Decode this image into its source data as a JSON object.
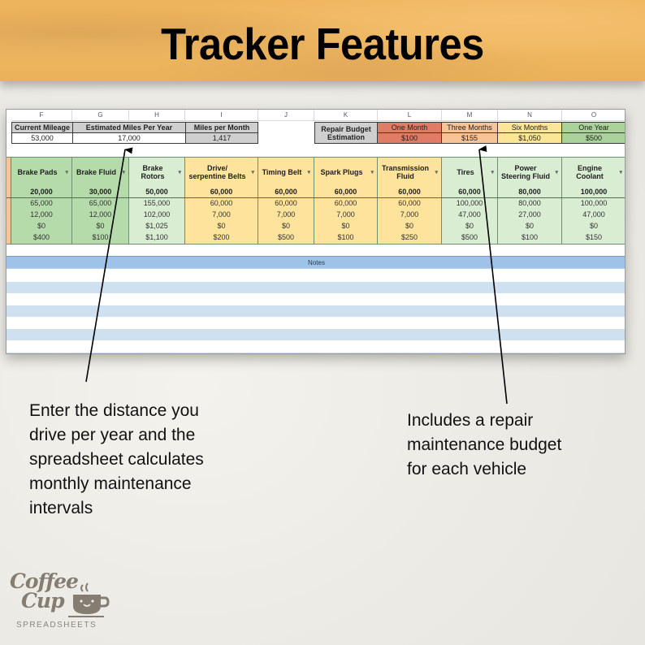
{
  "banner": {
    "title": "Tracker Features"
  },
  "sheet": {
    "column_letters": [
      "F",
      "G",
      "H",
      "I",
      "J",
      "K",
      "L",
      "M",
      "N",
      "O"
    ],
    "mileage": {
      "current_label": "Current Mileage",
      "current_value": "53,000",
      "estimated_label": "Estimated Miles Per Year",
      "estimated_value": "17,000",
      "per_month_label": "Miles per Month",
      "per_month_value": "1,417"
    },
    "budget": {
      "label": "Repair Budget Estimation",
      "periods": [
        {
          "label": "One Month",
          "value": "$100",
          "color": "#e07b67"
        },
        {
          "label": "Three Months",
          "value": "$155",
          "color": "#f7c49a"
        },
        {
          "label": "Six Months",
          "value": "$1,050",
          "color": "#fde597"
        },
        {
          "label": "One Year",
          "value": "$500",
          "color": "#a9d39a"
        }
      ]
    },
    "maintenance_items": [
      {
        "name": "Brake Pads",
        "interval": "20,000",
        "values": [
          "65,000",
          "12,000",
          "$0",
          "$400"
        ],
        "color": "#b6dbab"
      },
      {
        "name": "Brake Fluid",
        "interval": "30,000",
        "values": [
          "65,000",
          "12,000",
          "$0",
          "$100"
        ],
        "color": "#b6dbab"
      },
      {
        "name": "Brake\nRotors",
        "interval": "50,000",
        "values": [
          "155,000",
          "102,000",
          "$1,025",
          "$1,100"
        ],
        "color": "#d9edd3"
      },
      {
        "name": "Drive/\nserpentine Belts",
        "interval": "60,000",
        "values": [
          "60,000",
          "7,000",
          "$0",
          "$200"
        ],
        "color": "#fde39b"
      },
      {
        "name": "Timing Belt",
        "interval": "60,000",
        "values": [
          "60,000",
          "7,000",
          "$0",
          "$500"
        ],
        "color": "#fde39b"
      },
      {
        "name": "Spark Plugs",
        "interval": "60,000",
        "values": [
          "60,000",
          "7,000",
          "$0",
          "$100"
        ],
        "color": "#fde39b"
      },
      {
        "name": "Transmission\nFluid",
        "interval": "60,000",
        "values": [
          "60,000",
          "7,000",
          "$0",
          "$250"
        ],
        "color": "#fde39b"
      },
      {
        "name": "Tires",
        "interval": "60,000",
        "values": [
          "100,000",
          "47,000",
          "$0",
          "$500"
        ],
        "color": "#d9edd3"
      },
      {
        "name": "Power\nSteering Fluid",
        "interval": "80,000",
        "values": [
          "80,000",
          "27,000",
          "$0",
          "$100"
        ],
        "color": "#d9edd3"
      },
      {
        "name": "Engine\nCoolant",
        "interval": "100,000",
        "values": [
          "100,000",
          "47,000",
          "$0",
          "$150"
        ],
        "color": "#d9edd3"
      }
    ],
    "notes_label": "Notes",
    "left_edge_color": "#f7c49a"
  },
  "callouts": {
    "left": "Enter the distance you drive per year and the spreadsheet calculates monthly maintenance intervals",
    "left_lines": [
      "Enter the distance you",
      "drive per year and the",
      "spreadsheet calculates",
      "monthly maintenance",
      "intervals"
    ],
    "right_lines": [
      "Includes a repair",
      "maintenance budget",
      "for each vehicle"
    ]
  },
  "logo": {
    "word_top": "Coffee",
    "word_bottom": "Cup",
    "subtitle": "SPREADSHEETS"
  }
}
